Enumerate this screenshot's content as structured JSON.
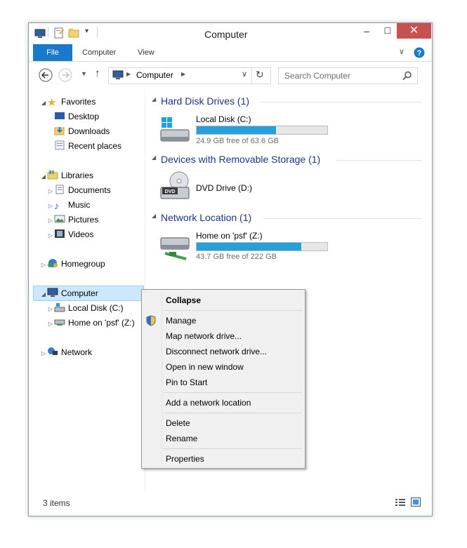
{
  "window": {
    "title": "Computer"
  },
  "ribbon": {
    "tabs": [
      "File",
      "Computer",
      "View"
    ]
  },
  "address": {
    "path": "Computer",
    "search_placeholder": "Search Computer"
  },
  "nav": {
    "favorites": {
      "label": "Favorites",
      "items": [
        "Desktop",
        "Downloads",
        "Recent places"
      ]
    },
    "libraries": {
      "label": "Libraries",
      "items": [
        "Documents",
        "Music",
        "Pictures",
        "Videos"
      ]
    },
    "homegroup": "Homegroup",
    "computer": {
      "label": "Computer",
      "items": [
        "Local Disk (C:)",
        "Home on 'psf' (Z:)"
      ]
    },
    "network": "Network"
  },
  "content": {
    "groups": [
      {
        "title": "Hard Disk Drives (1)"
      },
      {
        "title": "Devices with Removable Storage (1)"
      },
      {
        "title": "Network Location (1)"
      }
    ],
    "drives": [
      {
        "name": "Local Disk (C:)",
        "free": "24.9 GB free of 63.6 GB",
        "used_fraction": 0.61
      },
      {
        "name": "DVD Drive (D:)"
      },
      {
        "name": "Home on 'psf' (Z:)",
        "free": "43.7 GB free of 222 GB",
        "used_fraction": 0.8
      }
    ]
  },
  "context_menu": {
    "items": [
      "Collapse",
      "Manage",
      "Map network drive...",
      "Disconnect network drive...",
      "Open in new window",
      "Pin to Start",
      "Add a network location",
      "Delete",
      "Rename",
      "Properties"
    ]
  },
  "status": {
    "items": "3 items"
  },
  "colors": {
    "accent": "#1979ca",
    "bar": "#26a0da",
    "close": "#c75050",
    "group_title": "#1e3287"
  }
}
